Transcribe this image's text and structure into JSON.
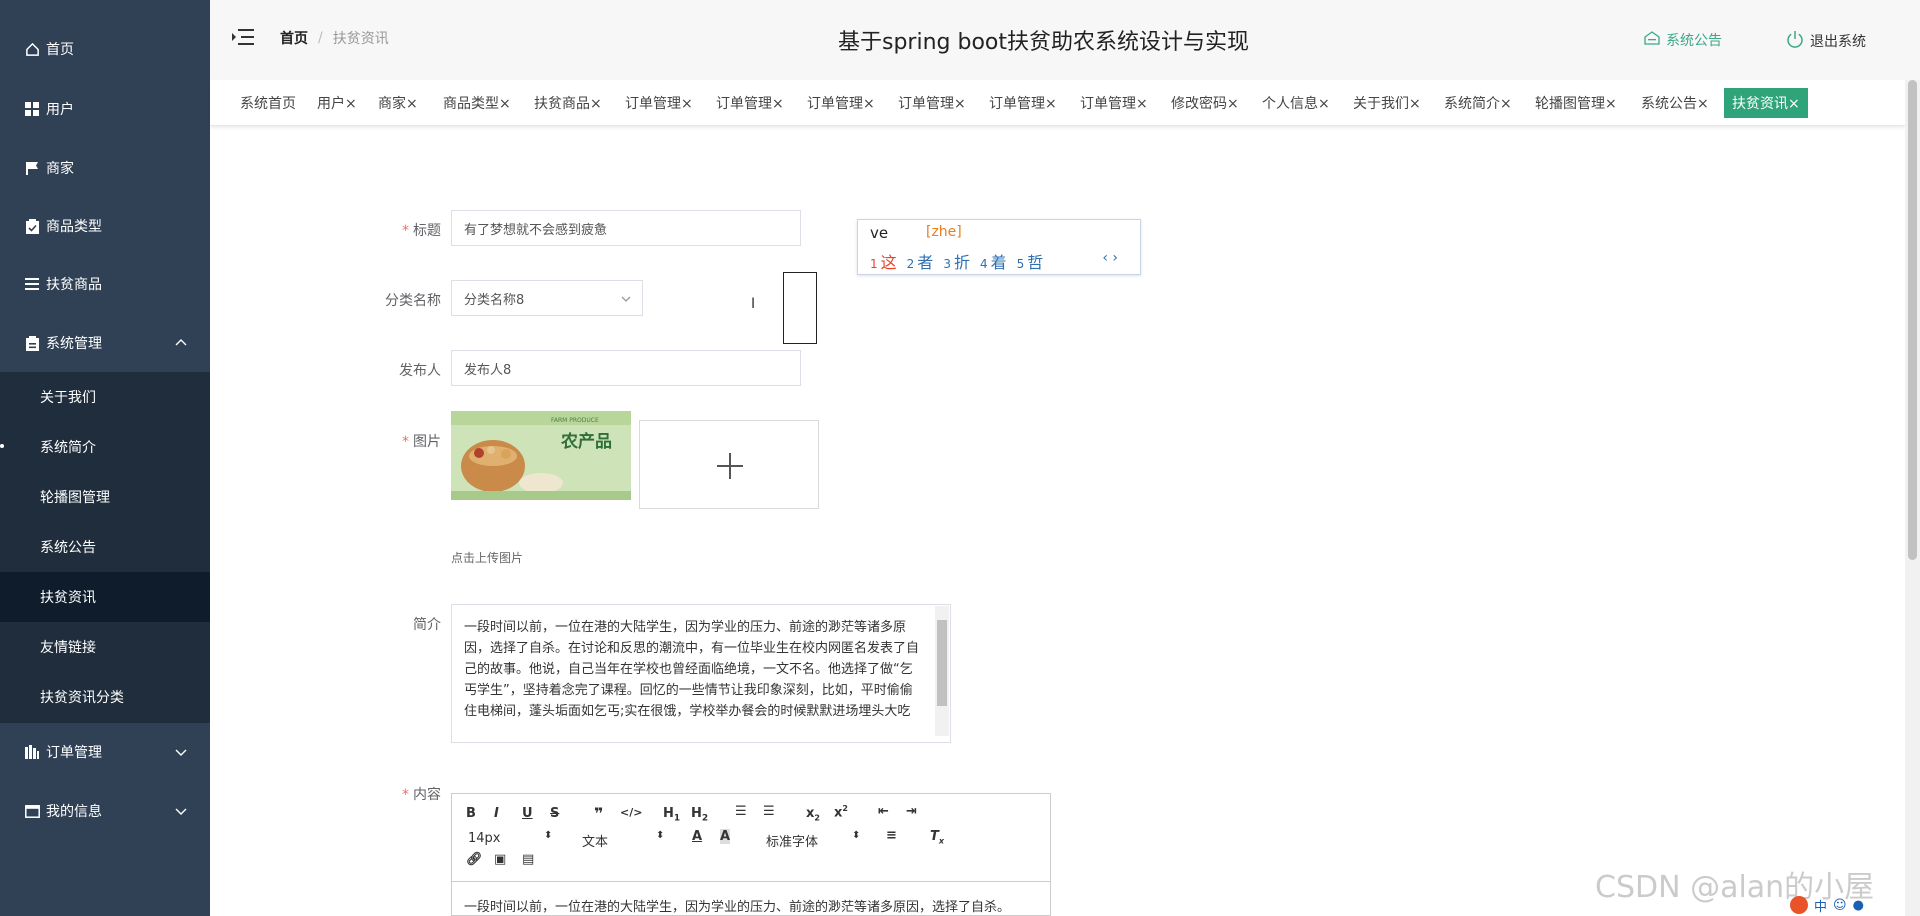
{
  "sidebar": {
    "items": [
      {
        "label": "首页",
        "icon": "home-icon"
      },
      {
        "label": "用户",
        "icon": "grid-icon"
      },
      {
        "label": "商家",
        "icon": "flag-icon"
      },
      {
        "label": "商品类型",
        "icon": "clipboard-icon"
      },
      {
        "label": "扶贫商品",
        "icon": "list-icon"
      },
      {
        "label": "系统管理",
        "icon": "clipboard-icon"
      },
      {
        "label": "订单管理",
        "icon": "bar-icon"
      },
      {
        "label": "我的信息",
        "icon": "window-icon"
      }
    ],
    "submenu": [
      {
        "label": "关于我们"
      },
      {
        "label": "系统简介"
      },
      {
        "label": "轮播图管理"
      },
      {
        "label": "系统公告"
      },
      {
        "label": "扶贫资讯"
      },
      {
        "label": "友情链接"
      },
      {
        "label": "扶贫资讯分类"
      }
    ]
  },
  "header": {
    "breadcrumb_home": "首页",
    "breadcrumb_sep": "/",
    "breadcrumb_current": "扶贫资讯",
    "title": "基于spring boot扶贫助农系统设计与实现",
    "notice_label": "系统公告",
    "logout_label": "退出系统",
    "accent": "#3ea788"
  },
  "tabs": [
    {
      "label": "系统首页"
    },
    {
      "label": "用户×"
    },
    {
      "label": "商家×"
    },
    {
      "label": "商品类型×"
    },
    {
      "label": "扶贫商品×"
    },
    {
      "label": "订单管理×"
    },
    {
      "label": "订单管理×"
    },
    {
      "label": "订单管理×"
    },
    {
      "label": "订单管理×"
    },
    {
      "label": "订单管理×"
    },
    {
      "label": "订单管理×"
    },
    {
      "label": "修改密码×"
    },
    {
      "label": "个人信息×"
    },
    {
      "label": "关于我们×"
    },
    {
      "label": "系统简介×"
    },
    {
      "label": "轮播图管理×"
    },
    {
      "label": "系统公告×"
    },
    {
      "label": "扶贫资讯×"
    }
  ],
  "form": {
    "title_label": "标题",
    "title_value": "有了梦想就不会感到疲惫",
    "category_label": "分类名称",
    "category_value": "分类名称8",
    "publisher_label": "发布人",
    "publisher_value": "发布人8",
    "image_label": "图片",
    "image_banner_text": "农产品",
    "image_banner_sub": "FARM PRODUCE",
    "upload_hint": "点击上传图片",
    "summary_label": "简介",
    "summary_value": "一段时间以前，一位在港的大陆学生，因为学业的压力、前途的渺茫等诸多原因，选择了自杀。在讨论和反思的潮流中，有一位毕业生在校内网匿名发表了自己的故事。他说，自己当年在学校也曾经面临绝境，一文不名。他选择了做“乞丐学生”，坚持着念完了课程。回忆的一些情节让我印象深刻，比如，平时偷偷住电梯间，蓬头垢面如乞丐;实在很饿，学校举办餐会的时候默默进场埋头大吃",
    "content_label": "内容",
    "required_mark": "*"
  },
  "editor": {
    "font_size": "14px",
    "block_type": "文本",
    "font_family": "标准字体",
    "body_text": "一段时间以前，一位在港的大陆学生，因为学业的压力、前途的渺茫等诸多原因，选择了自杀。"
  },
  "ime": {
    "typed": "ve",
    "pinyin": "[zhe]",
    "candidates": [
      {
        "num": "1",
        "char": "这"
      },
      {
        "num": "2",
        "char": "者"
      },
      {
        "num": "3",
        "char": "折"
      },
      {
        "num": "4",
        "char": "着"
      },
      {
        "num": "5",
        "char": "哲"
      }
    ],
    "nav": "‹ ›"
  },
  "watermark": "CSDN @alan的小屋",
  "tray": {
    "label": "中"
  }
}
